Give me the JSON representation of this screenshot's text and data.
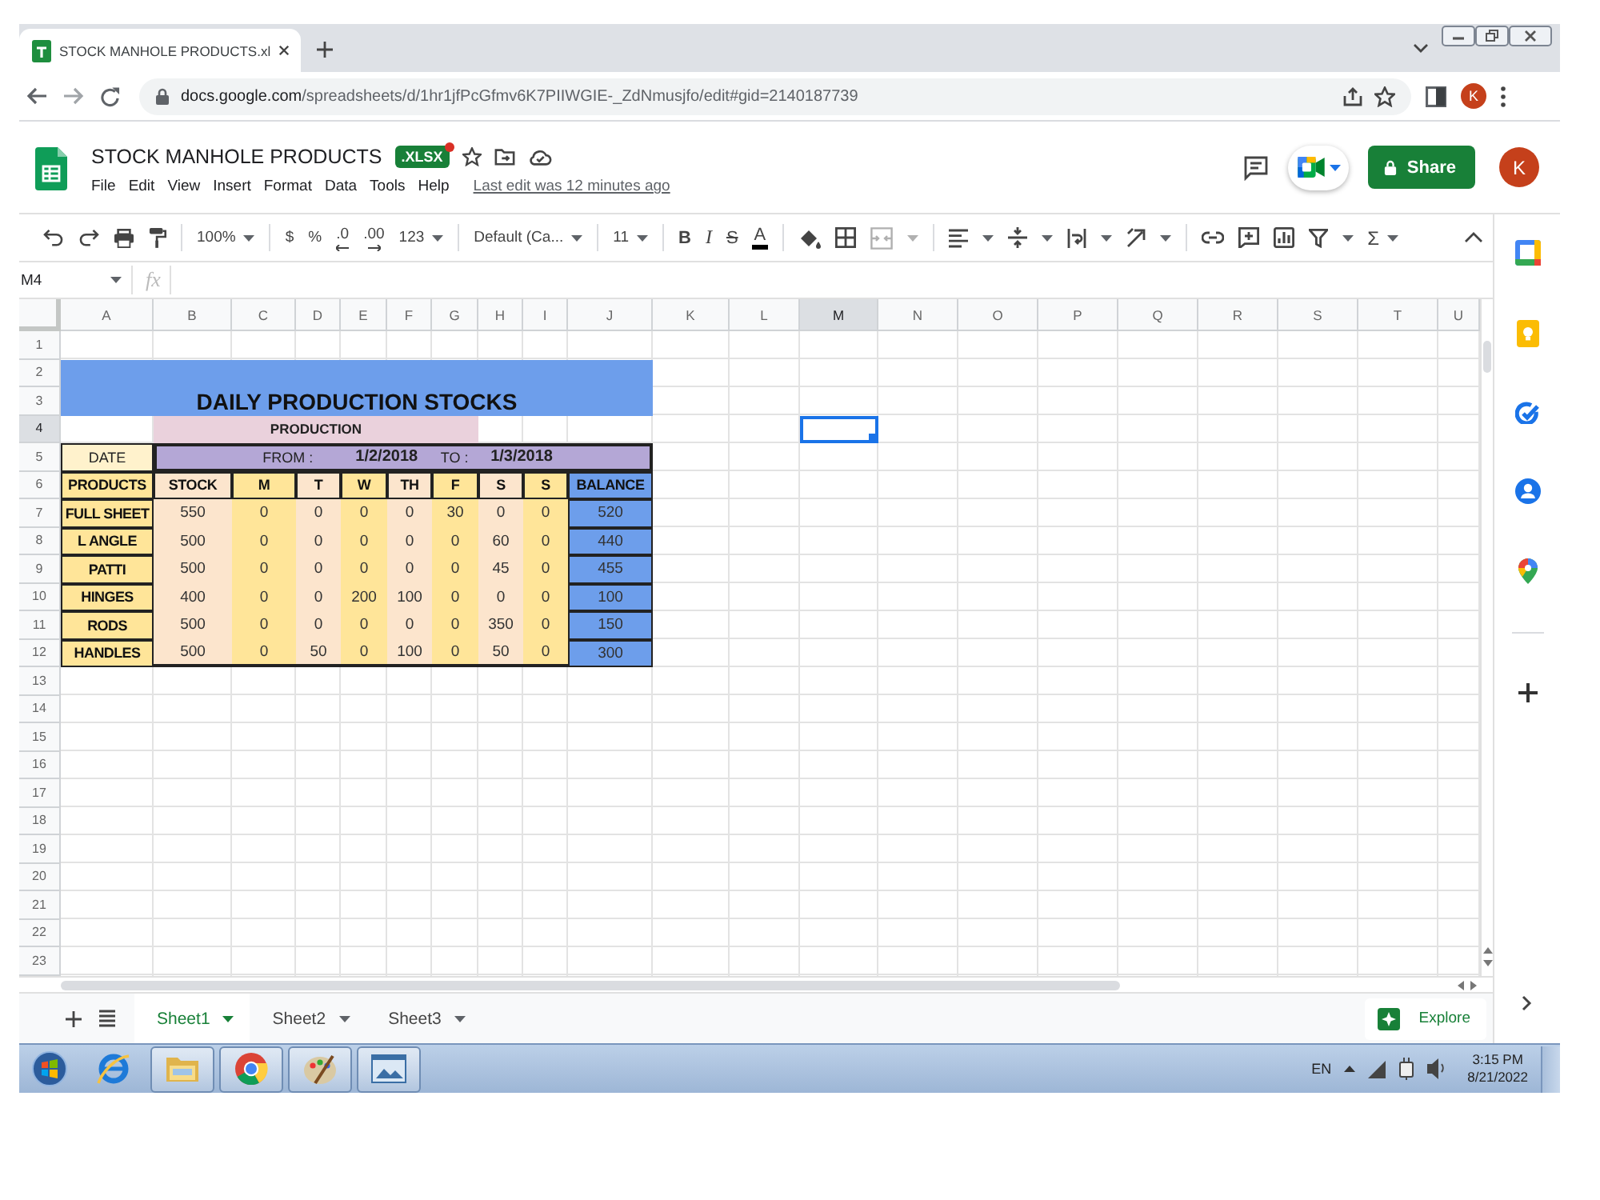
{
  "browser": {
    "tab_title": "STOCK MANHOLE PRODUCTS.xl",
    "address": {
      "host": "docs.google.com",
      "path": "/spreadsheets/d/1hr1jfPcGfmv6K7PIIWGIE-_ZdNmusjfo/edit#gid=2140187739"
    },
    "profile_initial": "K"
  },
  "doc": {
    "title": "STOCK MANHOLE PRODUCTS",
    "format_badge": ".XLSX",
    "menu": [
      "File",
      "Edit",
      "View",
      "Insert",
      "Format",
      "Data",
      "Tools",
      "Help"
    ],
    "last_edit": "Last edit was 12 minutes ago",
    "share_label": "Share",
    "account_initial": "K"
  },
  "toolbar": {
    "zoom": "100%",
    "currency": "$",
    "percent": "%",
    "decrease_decimals": ".0",
    "increase_decimals": ".00",
    "more_formats": "123",
    "font": "Default (Ca...",
    "font_size": "11",
    "bold": "B",
    "italic": "I",
    "strikethrough": "S",
    "text_color": "A",
    "functions": "Σ"
  },
  "formula_bar": {
    "name_box": "M4",
    "fx": "fx"
  },
  "sheet": {
    "columns": [
      {
        "label": "A",
        "selected": false
      },
      {
        "label": "B",
        "selected": false
      },
      {
        "label": "C",
        "selected": false
      },
      {
        "label": "D",
        "selected": false
      },
      {
        "label": "E",
        "selected": false
      },
      {
        "label": "F",
        "selected": false
      },
      {
        "label": "G",
        "selected": false
      },
      {
        "label": "H",
        "selected": false
      },
      {
        "label": "I",
        "selected": false
      },
      {
        "label": "J",
        "selected": false
      },
      {
        "label": "K",
        "selected": false
      },
      {
        "label": "L",
        "selected": false
      },
      {
        "label": "M",
        "selected": true
      },
      {
        "label": "N",
        "selected": false
      },
      {
        "label": "O",
        "selected": false
      },
      {
        "label": "P",
        "selected": false
      },
      {
        "label": "Q",
        "selected": false
      },
      {
        "label": "R",
        "selected": false
      },
      {
        "label": "S",
        "selected": false
      },
      {
        "label": "T",
        "selected": false
      },
      {
        "label": "U",
        "selected": false
      }
    ],
    "rows": [
      {
        "label": "1",
        "selected": false
      },
      {
        "label": "2",
        "selected": false
      },
      {
        "label": "3",
        "selected": false
      },
      {
        "label": "4",
        "selected": true
      },
      {
        "label": "5",
        "selected": false
      },
      {
        "label": "6",
        "selected": false
      },
      {
        "label": "7",
        "selected": false
      },
      {
        "label": "8",
        "selected": false
      },
      {
        "label": "9",
        "selected": false
      },
      {
        "label": "10",
        "selected": false
      },
      {
        "label": "11",
        "selected": false
      },
      {
        "label": "12",
        "selected": false
      },
      {
        "label": "13",
        "selected": false
      },
      {
        "label": "14",
        "selected": false
      },
      {
        "label": "15",
        "selected": false
      },
      {
        "label": "16",
        "selected": false
      },
      {
        "label": "17",
        "selected": false
      },
      {
        "label": "18",
        "selected": false
      },
      {
        "label": "19",
        "selected": false
      },
      {
        "label": "20",
        "selected": false
      },
      {
        "label": "21",
        "selected": false
      },
      {
        "label": "22",
        "selected": false
      },
      {
        "label": "23",
        "selected": false
      }
    ],
    "title": "DAILY PRODUCTION STOCKS",
    "section_label": "PRODUCTION",
    "date_label": "DATE",
    "date_range": {
      "from_label": "FROM :",
      "from": "1/2/2018",
      "to_label": "TO :",
      "to": "1/3/2018"
    },
    "headers": [
      {
        "text": "PRODUCTS",
        "color": "#ffe599"
      },
      {
        "text": "STOCK",
        "color": "#fce5cd"
      },
      {
        "text": "M",
        "color": "#ffe599"
      },
      {
        "text": "T",
        "color": "#fce5cd"
      },
      {
        "text": "W",
        "color": "#ffe599"
      },
      {
        "text": "TH",
        "color": "#fce5cd"
      },
      {
        "text": "F",
        "color": "#ffe599"
      },
      {
        "text": "S",
        "color": "#fce5cd"
      },
      {
        "text": "S",
        "color": "#ffe599"
      },
      {
        "text": "BALANCE",
        "color": "#6d9eeb"
      }
    ],
    "records": [
      [
        "FULL SHEET",
        "550",
        "0",
        "0",
        "0",
        "0",
        "30",
        "0",
        "0",
        "520"
      ],
      [
        "L ANGLE",
        "500",
        "0",
        "0",
        "0",
        "0",
        "0",
        "60",
        "0",
        "440"
      ],
      [
        "PATTI",
        "500",
        "0",
        "0",
        "0",
        "0",
        "0",
        "45",
        "0",
        "455"
      ],
      [
        "HINGES",
        "400",
        "0",
        "0",
        "200",
        "100",
        "0",
        "0",
        "0",
        "100"
      ],
      [
        "RODS",
        "500",
        "0",
        "0",
        "0",
        "0",
        "0",
        "350",
        "0",
        "150"
      ],
      [
        "HANDLES",
        "500",
        "0",
        "50",
        "0",
        "100",
        "0",
        "50",
        "0",
        "300"
      ]
    ]
  },
  "sheet_tabs": [
    {
      "label": "Sheet1",
      "selected": true
    },
    {
      "label": "Sheet2",
      "selected": false
    },
    {
      "label": "Sheet3",
      "selected": false
    }
  ],
  "explore_label": "Explore",
  "taskbar": {
    "apps": [
      {
        "running": false
      },
      {
        "running": true
      },
      {
        "running": true
      },
      {
        "running": true
      },
      {
        "running": true
      }
    ],
    "language": "EN",
    "time": "3:15 PM",
    "date": "8/21/2022"
  }
}
